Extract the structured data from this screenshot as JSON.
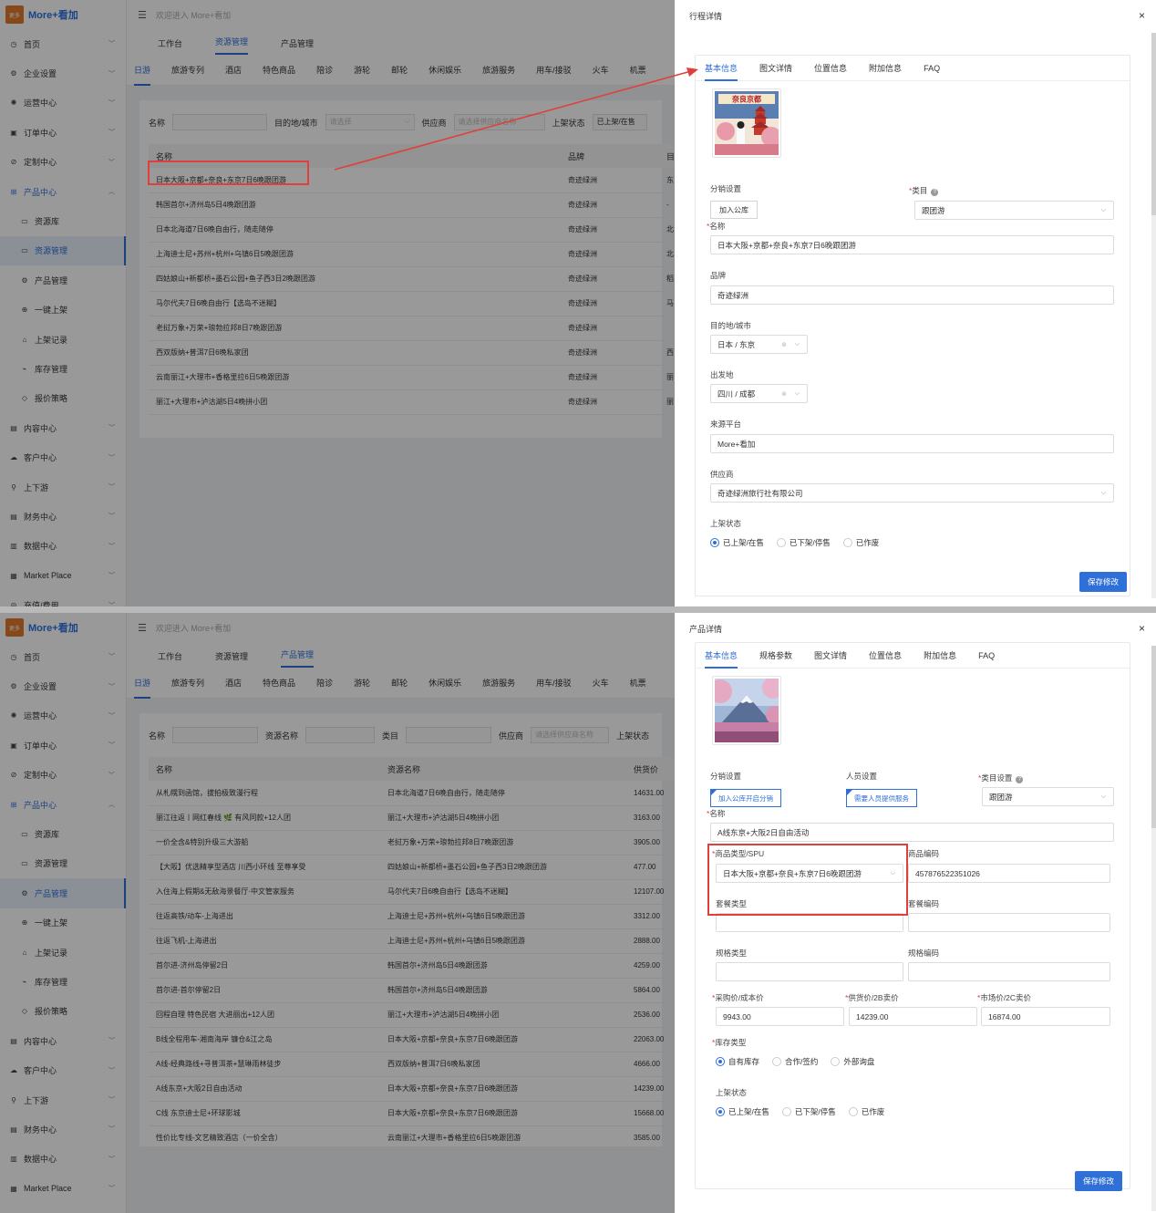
{
  "brand": {
    "logo_text": "更多",
    "name": "More+看加"
  },
  "topbar": {
    "welcome": "欢迎进入 More+看加"
  },
  "sidebar": {
    "items": [
      {
        "icon": "◷",
        "label": "首页",
        "kind": "top"
      },
      {
        "icon": "⚙",
        "label": "企业设置",
        "kind": "top"
      },
      {
        "icon": "✺",
        "label": "运营中心",
        "kind": "top"
      },
      {
        "icon": "▣",
        "label": "订单中心",
        "kind": "top"
      },
      {
        "icon": "⊘",
        "label": "定制中心",
        "kind": "top"
      },
      {
        "icon": "⊞",
        "label": "产品中心",
        "kind": "group"
      },
      {
        "icon": "▭",
        "label": "资源库",
        "kind": "sub"
      },
      {
        "icon": "▭",
        "label": "资源管理",
        "kind": "sub"
      },
      {
        "icon": "⚙",
        "label": "产品管理",
        "kind": "sub"
      },
      {
        "icon": "⊕",
        "label": "一键上架",
        "kind": "sub"
      },
      {
        "icon": "⌂",
        "label": "上架记录",
        "kind": "sub"
      },
      {
        "icon": "⌁",
        "label": "库存管理",
        "kind": "sub"
      },
      {
        "icon": "◇",
        "label": "报价策略",
        "kind": "sub"
      },
      {
        "icon": "▤",
        "label": "内容中心",
        "kind": "top"
      },
      {
        "icon": "☁",
        "label": "客户中心",
        "kind": "top"
      },
      {
        "icon": "⚲",
        "label": "上下游",
        "kind": "top"
      },
      {
        "icon": "▤",
        "label": "财务中心",
        "kind": "top"
      },
      {
        "icon": "▥",
        "label": "数据中心",
        "kind": "top"
      },
      {
        "icon": "▦",
        "label": "Market Place",
        "kind": "top"
      },
      {
        "icon": "◎",
        "label": "充值/费用",
        "kind": "top"
      }
    ]
  },
  "main_tabs": [
    "工作台",
    "资源管理",
    "产品管理"
  ],
  "category_tabs": [
    "日游",
    "旅游专列",
    "酒店",
    "特色商品",
    "陪诊",
    "游轮",
    "邮轮",
    "休闲娱乐",
    "旅游服务",
    "用车/接驳",
    "火车",
    "机票"
  ],
  "panel1": {
    "filters": {
      "name_label": "名称",
      "dest_label": "目的地/城市",
      "dest_placeholder": "请选择",
      "supplier_label": "供应商",
      "supplier_placeholder": "请选择供应商名称",
      "status_label": "上架状态",
      "status_value": "已上架/在售"
    },
    "table": {
      "headers": [
        "名称",
        "品牌",
        "目"
      ],
      "rows": [
        [
          "日本大阪+京都+奈良+东京7日6晚跟团游",
          "奇迹绿洲",
          "东"
        ],
        [
          "韩国首尔+济州岛5日4晚跟团游",
          "奇迹绿洲",
          "-"
        ],
        [
          "日本北海道7日6晚自由行，随走随停",
          "奇迹绿洲",
          "北"
        ],
        [
          "上海迪士尼+苏州+杭州+乌镇6日5晚跟团游",
          "奇迹绿洲",
          "北"
        ],
        [
          "四姑娘山+新都桥+墨石公园+鱼子西3日2晚跟团游",
          "奇迹绿洲",
          "稻"
        ],
        [
          "马尔代夫7日6晚自由行【选岛不迷糊】",
          "奇迹绿洲",
          "马"
        ],
        [
          "老挝万象+万荣+琅勃拉邦8日7晚跟团游",
          "奇迹绿洲",
          ""
        ],
        [
          "西双版纳+普洱7日6晚私家团",
          "奇迹绿洲",
          "西"
        ],
        [
          "云南丽江+大理市+香格里拉6日5晚跟团游",
          "奇迹绿洲",
          "丽"
        ],
        [
          "丽江+大理市+泸沽湖5日4晚拼小团",
          "奇迹绿洲",
          "丽"
        ]
      ]
    },
    "drawer": {
      "title": "行程详情",
      "close": "×",
      "tabs": [
        "基本信息",
        "图文详情",
        "位置信息",
        "附加信息",
        "FAQ"
      ],
      "image_alt": "奈良京都",
      "distribution_label": "分销设置",
      "distribution_button": "加入公库",
      "category_label": "类目",
      "category_value": "跟团游",
      "name_label": "名称",
      "name_value": "日本大阪+京都+奈良+东京7日6晚跟团游",
      "brand_label": "品牌",
      "brand_value": "奇迹绿洲",
      "dest_label": "目的地/城市",
      "dest_value": "日本 / 东京",
      "depart_label": "出发地",
      "depart_value": "四川 / 成都",
      "source_label": "来源平台",
      "source_value": "More+看加",
      "supplier_label": "供应商",
      "supplier_value": "奇迹绿洲旅行社有限公司",
      "status_label": "上架状态",
      "status_options": [
        "已上架/在售",
        "已下架/停售",
        "已作废"
      ],
      "save": "保存修改"
    }
  },
  "panel2": {
    "filters": {
      "name_label": "名称",
      "res_label": "资源名称",
      "cat_label": "类目",
      "supplier_label": "供应商",
      "supplier_placeholder": "请选择供应商名称",
      "status_label": "上架状态"
    },
    "table": {
      "headers": [
        "名称",
        "资源名称",
        "供货价"
      ],
      "rows": [
        [
          "从札幌到函馆，拔拍极致漫行程",
          "日本北海道7日6晚自由行，随走随停",
          "14631.00"
        ],
        [
          "丽江往返丨网红春线 🌿 有风同款+12人团",
          "丽江+大理市+泸沽湖5日4晚拼小团",
          "3163.00"
        ],
        [
          "一价全含&特别升级三大游船",
          "老挝万象+万荣+琅勃拉邦8日7晚跟团游",
          "3905.00"
        ],
        [
          "【大阪】优选精享型酒店 川西小环线 至尊享受",
          "四姑娘山+新都桥+墨石公园+鱼子西3日2晚跟团游",
          "477.00"
        ],
        [
          "入住海上假期&无敌海景餐厅·中文管家服务",
          "马尔代夫7日6晚自由行【选岛不迷糊】",
          "12107.00"
        ],
        [
          "往返高铁/动车-上海进出",
          "上海迪士尼+苏州+杭州+乌镇6日5晚跟团游",
          "3312.00"
        ],
        [
          "往返飞机-上海进出",
          "上海迪士尼+苏州+杭州+乌镇6日5晚跟团游",
          "2888.00"
        ],
        [
          "首尔进-济州岛停留2日",
          "韩国首尔+济州岛5日4晚跟团游",
          "4259.00"
        ],
        [
          "首尔进-首尔停留2日",
          "韩国首尔+济州岛5日4晚跟团游",
          "5864.00"
        ],
        [
          "回程自理 特色民宿 大进丽出+12人团",
          "丽江+大理市+泸沽湖5日4晚拼小团",
          "2536.00"
        ],
        [
          "B线全程用车-湘南海岸 镰仓&江之岛",
          "日本大阪+京都+奈良+东京7日6晚跟团游",
          "22063.00"
        ],
        [
          "A线-经典路线+寻普洱茶+慧琳雨林徒步",
          "西双版纳+普洱7日6晚私家团",
          "4666.00"
        ],
        [
          "A线东京+大阪2日自由活动",
          "日本大阪+京都+奈良+东京7日6晚跟团游",
          "14239.00"
        ],
        [
          "C线 东京迪士尼+环球影城",
          "日本大阪+京都+奈良+东京7日6晚跟团游",
          "15668.00"
        ],
        [
          "性价比专线-文艺精致酒店（一价全含）",
          "云南丽江+大理市+香格里拉6日5晚跟团游",
          "3585.00"
        ]
      ]
    },
    "drawer": {
      "title": "产品详情",
      "close": "×",
      "tabs": [
        "基本信息",
        "规格参数",
        "图文详情",
        "位置信息",
        "附加信息",
        "FAQ"
      ],
      "distribution_label": "分销设置",
      "distribution_button": "加入公库开启分销",
      "personnel_label": "人员设置",
      "personnel_button": "需要人员提供服务",
      "category_label": "类目设置",
      "category_value": "跟团游",
      "name_label": "名称",
      "name_value": "A线东京+大阪2日自由活动",
      "spu_label": "商品类型/SPU",
      "spu_value": "日本大阪+京都+奈良+东京7日6晚跟团游",
      "code_label": "商品编码",
      "code_value": "457876522351026",
      "package_type_label": "套餐类型",
      "package_code_label": "套餐编码",
      "spec_type_label": "规格类型",
      "spec_code_label": "规格编码",
      "cost_label": "采购价/成本价",
      "cost_value": "9943.00",
      "supply_label": "供货价/2B卖价",
      "supply_value": "14239.00",
      "market_label": "市场价/2C卖价",
      "market_value": "16874.00",
      "stock_label": "库存类型",
      "stock_options": [
        "自有库存",
        "合作/签约",
        "外部询盘"
      ],
      "status_label": "上架状态",
      "status_options": [
        "已上架/在售",
        "已下架/停售",
        "已作废"
      ],
      "save": "保存修改"
    }
  },
  "colors": {
    "accent": "#2f6fd8",
    "annotation": "#e0403b",
    "brand_orange": "#e07a2e"
  }
}
